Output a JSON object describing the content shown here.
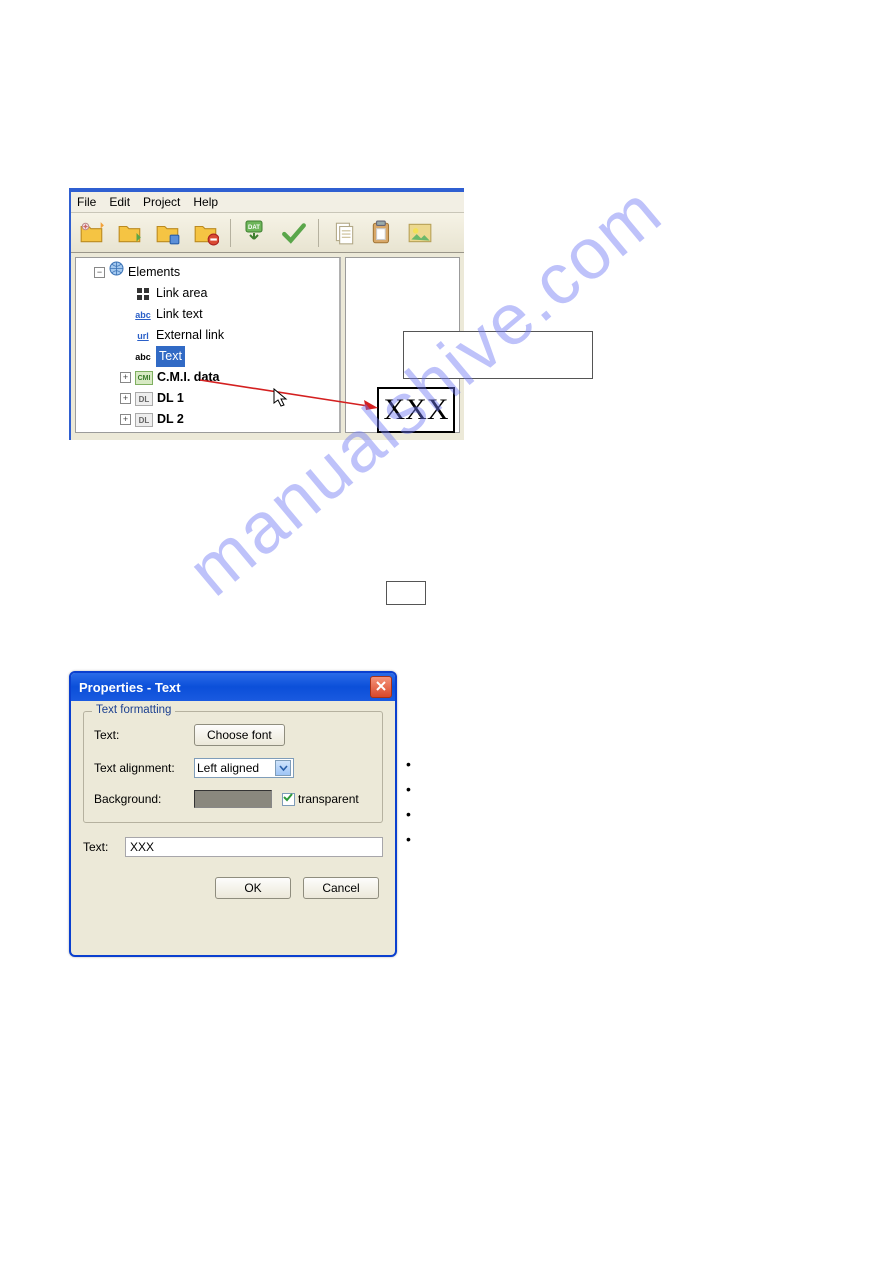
{
  "watermark": "manualshive.com",
  "menubar": {
    "items": [
      "File",
      "Edit",
      "Project",
      "Help"
    ]
  },
  "tree": {
    "root": "Elements",
    "items": [
      {
        "icon": "link-area",
        "label": "Link area"
      },
      {
        "icon": "abc-link",
        "label": "Link text"
      },
      {
        "icon": "url",
        "label": "External link"
      },
      {
        "icon": "abc",
        "label": "Text",
        "selected": true
      },
      {
        "icon": "cmi",
        "label": "C.M.I. data",
        "expandable": true
      },
      {
        "icon": "dl",
        "label": "DL 1",
        "expandable": true
      },
      {
        "icon": "dl",
        "label": "DL 2",
        "expandable": true
      }
    ]
  },
  "placeholder_text": "XXX",
  "bullets": [
    "",
    "",
    "",
    ""
  ],
  "dialog": {
    "title": "Properties - Text",
    "fieldset_legend": "Text formatting",
    "rows": {
      "text_label": "Text:",
      "choose_font": "Choose font",
      "alignment_label": "Text alignment:",
      "alignment_value": "Left aligned",
      "background_label": "Background:",
      "transparent_label": "transparent"
    },
    "text_input_label": "Text:",
    "text_input_value": "XXX",
    "ok": "OK",
    "cancel": "Cancel"
  }
}
